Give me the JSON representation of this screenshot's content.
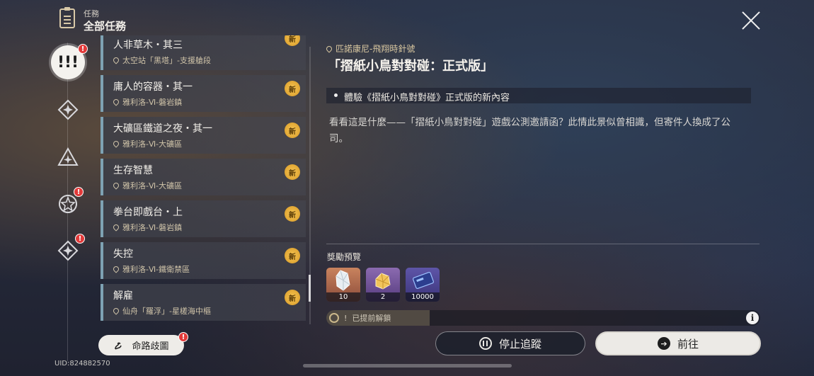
{
  "header": {
    "kicker": "任務",
    "title": "全部任務"
  },
  "rail": {
    "items": [
      {
        "name": "quest-category-main",
        "icon": "triple-exclamation-icon",
        "active": true,
        "badge": "!"
      },
      {
        "name": "quest-category-companion",
        "icon": "diamond-star-icon",
        "active": false,
        "badge": ""
      },
      {
        "name": "quest-category-adventure",
        "icon": "triangle-star-icon",
        "active": false,
        "badge": ""
      },
      {
        "name": "quest-category-event",
        "icon": "star-circle-icon",
        "active": false,
        "badge": "!"
      },
      {
        "name": "quest-category-daily",
        "icon": "diamond-star-icon",
        "active": false,
        "badge": "!"
      }
    ]
  },
  "quests": [
    {
      "name": "人非草木・其三",
      "location": "太空站「黑塔」-支援艙段",
      "badge": "新"
    },
    {
      "name": "庸人的容器・其一",
      "location": "雅利洛-Ⅵ-磐岩鎮",
      "badge": "新"
    },
    {
      "name": "大礦區鐵道之夜・其一",
      "location": "雅利洛-Ⅵ-大礦區",
      "badge": "新"
    },
    {
      "name": "生存智慧",
      "location": "雅利洛-Ⅵ-大礦區",
      "badge": "新"
    },
    {
      "name": "拳台即戲台・上",
      "location": "雅利洛-Ⅵ-磐岩鎮",
      "badge": "新"
    },
    {
      "name": "失控",
      "location": "雅利洛-Ⅵ-鐵衛禁區",
      "badge": "新"
    },
    {
      "name": "解雇",
      "location": "仙舟「羅浮」-星槎海中樞",
      "badge": "新"
    }
  ],
  "detail": {
    "location": "匹諾康尼-飛翔時針號",
    "title": "「摺紙小鳥對對碰：正式版」",
    "objective": "體驗《摺紙小鳥對對碰》正式版的新內容",
    "description": "看看這是什麼——「摺紙小鳥對對碰」遊戲公測邀請函？此情此景似曾相識，但寄件人換成了公司。",
    "reward_label": "獎勵預覽",
    "rewards": [
      {
        "icon": "crystal-shard-icon",
        "qty": "10",
        "color": "#b0694a"
      },
      {
        "icon": "gold-ore-icon",
        "qty": "2",
        "color": "#6d4a8f"
      },
      {
        "icon": "blue-credit-icon",
        "qty": "10000",
        "color": "#4a3f86"
      }
    ],
    "unlock_text": "已提前解鎖",
    "unlock_prefix": "!",
    "unlock_progress": 0.24
  },
  "buttons": {
    "stop_tracking": "停止追蹤",
    "go": "前往",
    "destiny": "命路歧圖"
  },
  "uid": "UID:824882570"
}
